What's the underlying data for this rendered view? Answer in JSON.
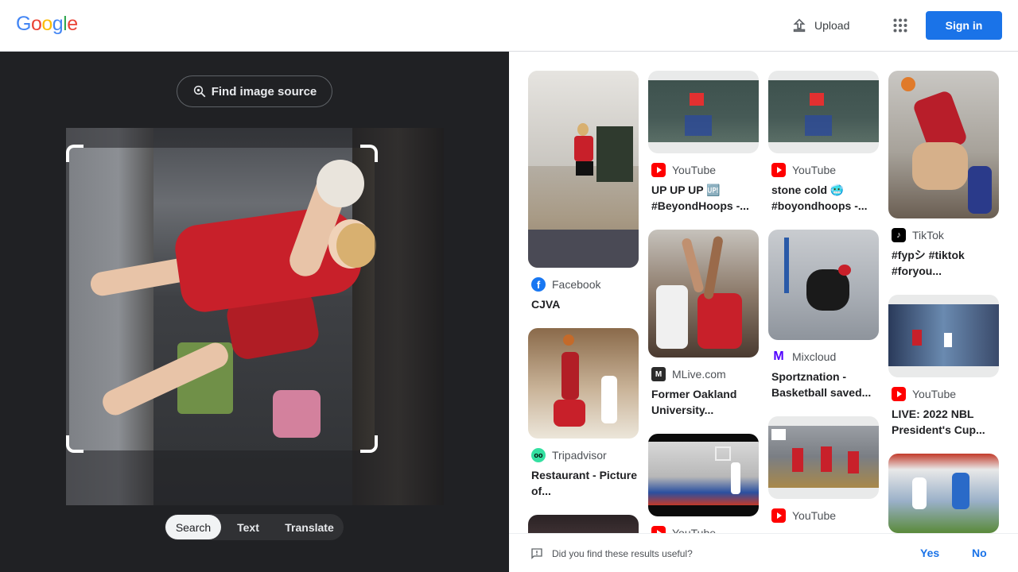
{
  "header": {
    "logo_letters": [
      {
        "ch": "G",
        "color": "#4285F4"
      },
      {
        "ch": "o",
        "color": "#EA4335"
      },
      {
        "ch": "o",
        "color": "#FBBC05"
      },
      {
        "ch": "g",
        "color": "#4285F4"
      },
      {
        "ch": "l",
        "color": "#34A853"
      },
      {
        "ch": "e",
        "color": "#EA4335"
      }
    ],
    "upload_label": "Upload",
    "signin_label": "Sign in"
  },
  "left": {
    "find_source_label": "Find image source",
    "tabs": [
      {
        "label": "Search",
        "active": true
      },
      {
        "label": "Text",
        "active": false
      },
      {
        "label": "Translate",
        "active": false
      }
    ]
  },
  "results": {
    "col1": [
      {
        "source": "Facebook",
        "icon": "facebook-icon",
        "title": "CJVA"
      },
      {
        "source": "Tripadvisor",
        "icon": "tripadvisor-icon",
        "title": "Restaurant - Picture of..."
      }
    ],
    "col2": [
      {
        "source": "YouTube",
        "icon": "youtube-icon",
        "title": "UP UP UP 🆙 #BeyondHoops -..."
      },
      {
        "source": "MLive.com",
        "icon": "mlive-icon",
        "title": "Former Oakland University..."
      },
      {
        "source": "YouTube",
        "icon": "youtube-icon",
        "title": ""
      }
    ],
    "col3": [
      {
        "source": "YouTube",
        "icon": "youtube-icon",
        "title": "stone cold 🥶 #boyondhoops -..."
      },
      {
        "source": "Mixcloud",
        "icon": "mixcloud-icon",
        "title": "Sportznation - Basketball saved..."
      },
      {
        "source": "YouTube",
        "icon": "youtube-icon",
        "title": ""
      }
    ],
    "col4": [
      {
        "source": "TikTok",
        "icon": "tiktok-icon",
        "title": "#fypシ #tiktok #foryou..."
      },
      {
        "source": "YouTube",
        "icon": "youtube-icon",
        "title": "LIVE: 2022 NBL President's Cup..."
      }
    ]
  },
  "feedback": {
    "question": "Did you find these results useful?",
    "yes": "Yes",
    "no": "No"
  },
  "colors": {
    "accent": "#1a73e8",
    "left_bg": "#202124"
  }
}
